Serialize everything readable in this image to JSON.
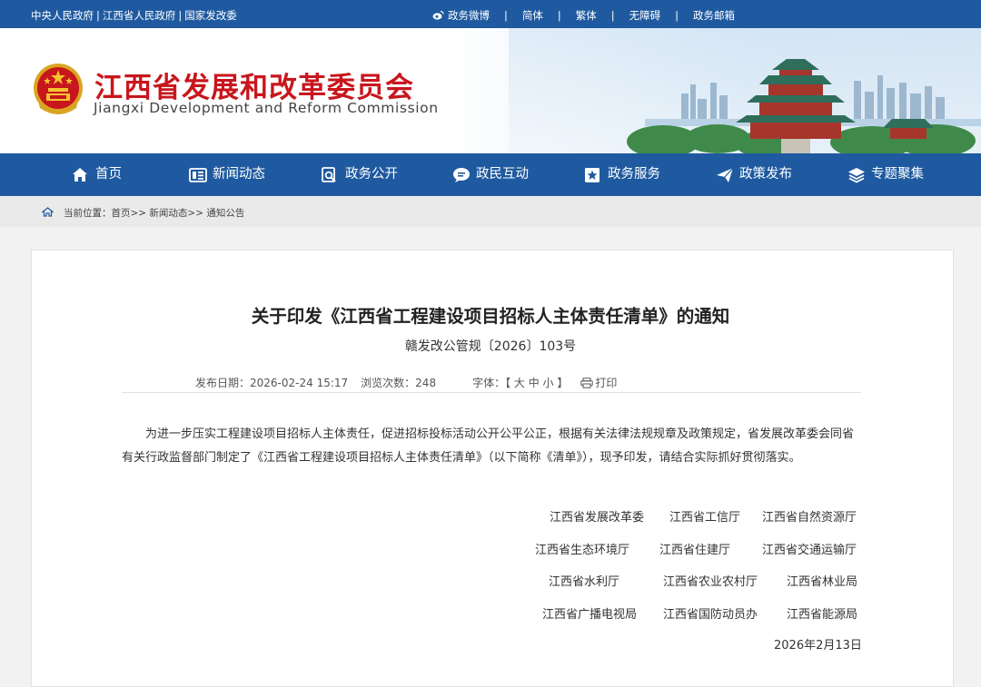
{
  "topbar": {
    "left_links": [
      "中央人民政府",
      "江西省人民政府",
      "国家发改委"
    ],
    "separator": "|",
    "right_links": [
      "政务微博",
      "简体",
      "繁体",
      "无障碍",
      "政务邮箱"
    ]
  },
  "header": {
    "name_cn": "江西省发展和改革委员会",
    "name_en": "Jiangxi Development and Reform Commission"
  },
  "nav": {
    "items": [
      {
        "label": "首页",
        "icon": "home-icon"
      },
      {
        "label": "新闻动态",
        "icon": "news-icon"
      },
      {
        "label": "政务公开",
        "icon": "search-doc-icon"
      },
      {
        "label": "政民互动",
        "icon": "chat-icon"
      },
      {
        "label": "政务服务",
        "icon": "star-icon"
      },
      {
        "label": "政策发布",
        "icon": "send-icon"
      },
      {
        "label": "专题聚集",
        "icon": "layers-icon"
      }
    ]
  },
  "breadcrumb": {
    "text": "当前位置：首页>> 新闻动态>> 通知公告"
  },
  "article": {
    "title": "关于印发《江西省工程建设项目招标人主体责任清单》的通知",
    "doc_number": "赣发改公管规〔2026〕103号",
    "publish_label": "发布日期：",
    "publish_date": "2026-02-24 15:17",
    "views_label": "浏览次数：",
    "views": "248",
    "font_label": "字体：",
    "font_sizes": "【 大 中 小 】",
    "print_label": "打印",
    "body": "为进一步压实工程建设项目招标人主体责任，促进招标投标活动公开公平公正，根据有关法律法规规章及政策规定，省发展改革委会同省有关行政监督部门制定了《江西省工程建设项目招标人主体责任清单》（以下简称《清单》），现予印发，请结合实际抓好贯彻落实。",
    "orgs": [
      [
        "江西省发展改革委",
        "江西省工信厅",
        "江西省自然资源厅"
      ],
      [
        "江西省生态环境厅",
        "江西省住建厅",
        "江西省交通运输厅"
      ],
      [
        "江西省水利厅",
        "江西省农业农村厅",
        "江西省林业局"
      ],
      [
        "江西省广播电视局",
        "江西省国防动员办",
        "江西省能源局"
      ]
    ],
    "date": "2026年2月13日"
  },
  "colors": {
    "primary": "#1f5aa0",
    "brand_red": "#c8161d"
  }
}
